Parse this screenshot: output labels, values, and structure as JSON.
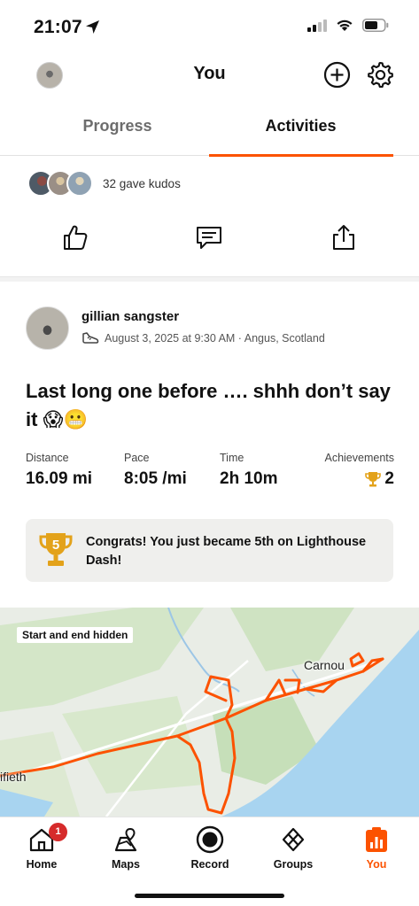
{
  "status": {
    "time": "21:07",
    "location_icon": "location-arrow-icon",
    "signal_icon": "cell-signal-icon",
    "wifi_icon": "wifi-icon",
    "battery_icon": "battery-icon"
  },
  "header": {
    "title": "You",
    "add_icon": "plus-circle-icon",
    "settings_icon": "gear-icon"
  },
  "tabs": [
    {
      "label": "Progress",
      "active": false
    },
    {
      "label": "Activities",
      "active": true
    }
  ],
  "kudos": {
    "text": "32 gave kudos"
  },
  "activity": {
    "athlete": "gillian sangster",
    "meta": "August 3, 2025 at 9:30 AM · Angus, Scotland",
    "title": "Last long one before …. shhh don’t say it 😱😬",
    "stats": [
      {
        "label": "Distance",
        "value": "16.09 mi"
      },
      {
        "label": "Pace",
        "value": "8:05 /mi"
      },
      {
        "label": "Time",
        "value": "2h 10m"
      },
      {
        "label": "Achievements",
        "value": "2"
      }
    ],
    "achievement": {
      "badge_number": "5",
      "text": "Congrats! You just became 5th on Lighthouse Dash!"
    }
  },
  "map": {
    "badge": "Start and end hidden",
    "label_east": "Carnou",
    "label_west": "ifieth"
  },
  "nav": [
    {
      "label": "Home",
      "icon": "home-icon",
      "badge": "1"
    },
    {
      "label": "Maps",
      "icon": "map-icon"
    },
    {
      "label": "Record",
      "icon": "record-icon"
    },
    {
      "label": "Groups",
      "icon": "groups-icon"
    },
    {
      "label": "You",
      "icon": "you-icon",
      "active": true
    }
  ],
  "colors": {
    "accent": "#fc5200",
    "route": "#fc5200",
    "water": "#a8d4f0",
    "park": "#c6dfb9",
    "trophy": "#e3a21a"
  }
}
